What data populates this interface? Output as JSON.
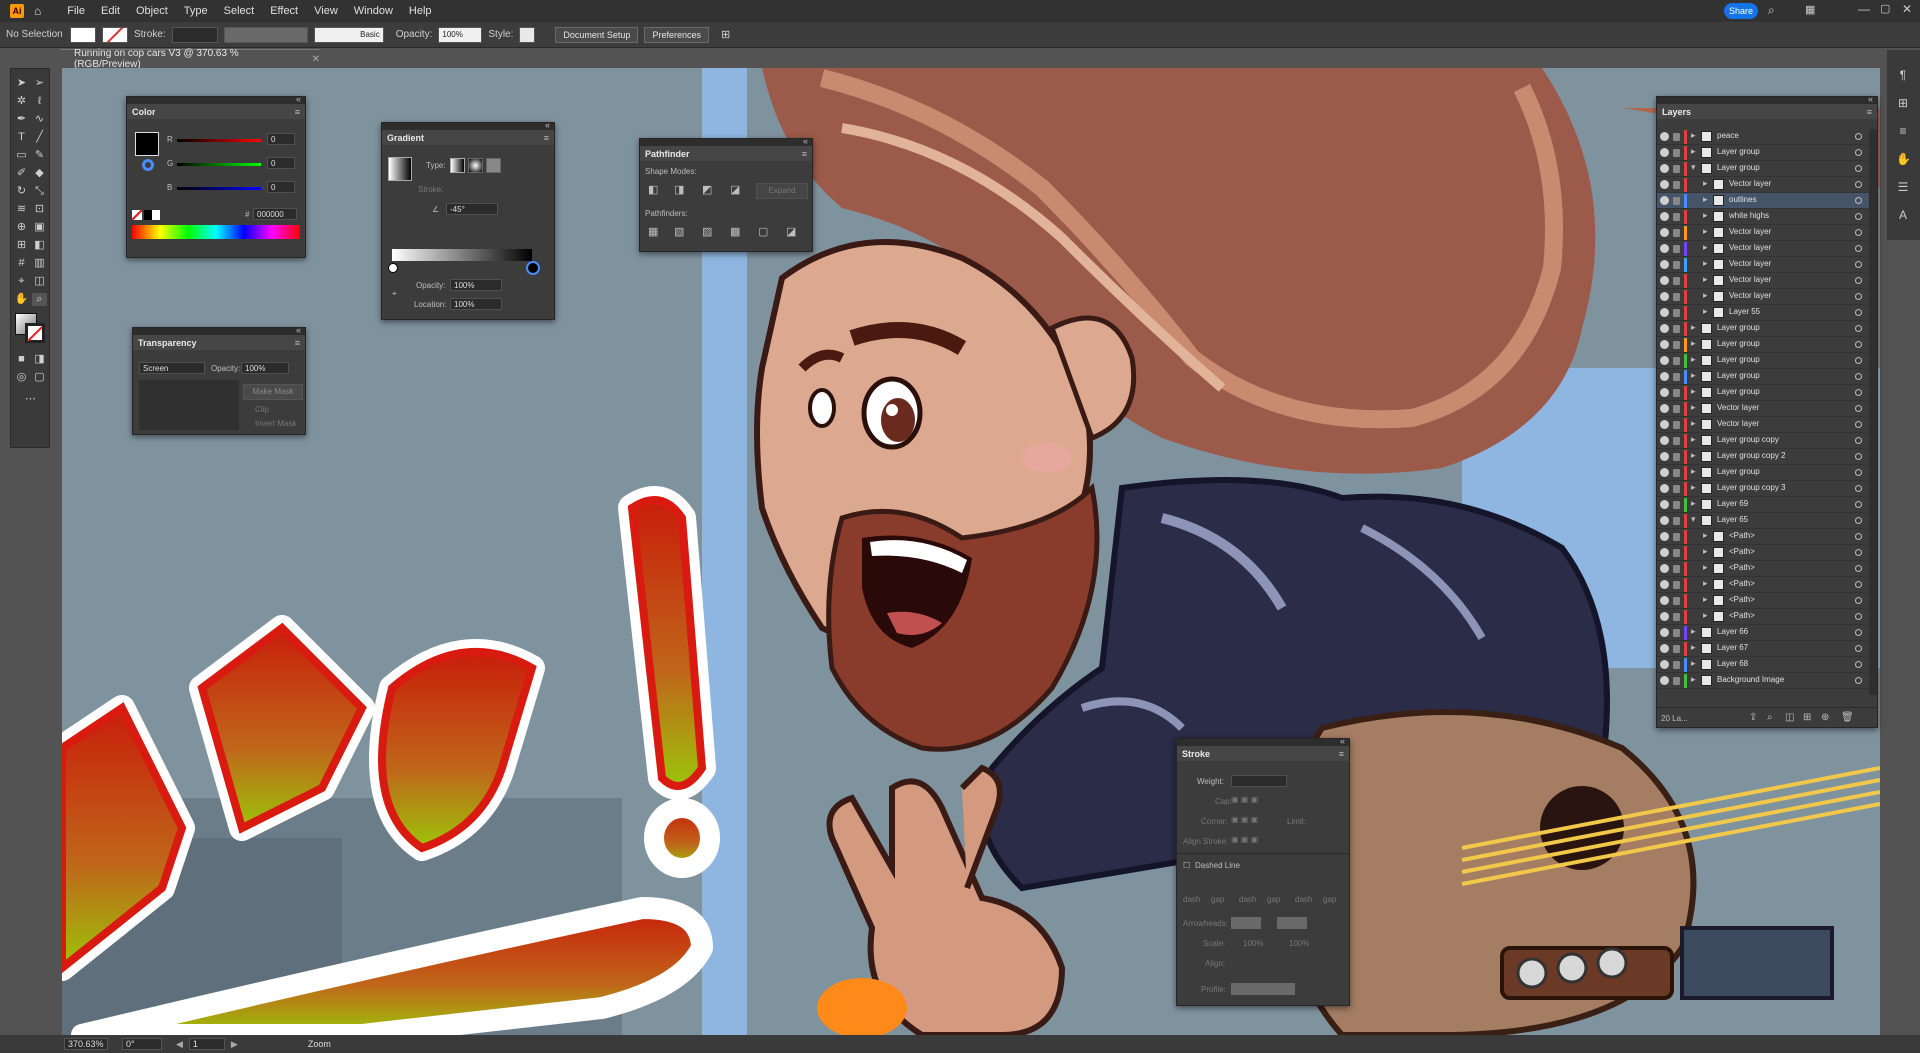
{
  "app": {
    "logo": "Ai",
    "share_label": "Share"
  },
  "menu": [
    "File",
    "Edit",
    "Object",
    "Type",
    "Select",
    "Effect",
    "View",
    "Window",
    "Help"
  ],
  "control_bar": {
    "selection": "No Selection",
    "stroke_label": "Stroke:",
    "brush_label": "Basic",
    "opacity_label": "Opacity:",
    "opacity_value": "100%",
    "style_label": "Style:",
    "document_setup": "Document Setup",
    "preferences": "Preferences"
  },
  "document_tab": {
    "title": "Running on cop cars V3 @ 370.63 % (RGB/Preview)"
  },
  "color_panel": {
    "title": "Color",
    "channels": [
      {
        "label": "R",
        "value": "0"
      },
      {
        "label": "G",
        "value": "0"
      },
      {
        "label": "B",
        "value": "0"
      }
    ],
    "hex_prefix": "#",
    "hex": "000000"
  },
  "gradient_panel": {
    "title": "Gradient",
    "type_label": "Type:",
    "stroke_label": "Stroke:",
    "angle": "-45°",
    "opacity_label": "Opacity:",
    "opacity": "100%",
    "location_label": "Location:",
    "location": "100%"
  },
  "pathfinder_panel": {
    "title": "Pathfinder",
    "shape_modes": "Shape Modes:",
    "expand": "Expand",
    "pathfinders": "Pathfinders:"
  },
  "transparency_panel": {
    "title": "Transparency",
    "mode": "Screen",
    "opacity_label": "Opacity:",
    "opacity": "100%",
    "make_mask": "Make Mask",
    "clip": "Clip",
    "invert_mask": "Invert Mask"
  },
  "stroke_panel": {
    "title": "Stroke",
    "weight_label": "Weight:",
    "cap_label": "Cap:",
    "corner_label": "Corner:",
    "limit_label": "Limit:",
    "align_label": "Align Stroke:",
    "dashed_line": "Dashed Line",
    "dash_labels": [
      "dash",
      "gap",
      "dash",
      "gap",
      "dash",
      "gap"
    ],
    "arrowheads_label": "Arrowheads:",
    "scale_label": "Scale:",
    "scale_values": [
      "100%",
      "100%"
    ],
    "align2_label": "Align:",
    "profile_label": "Profile:"
  },
  "layers_panel": {
    "title": "Layers",
    "footer": "20 La...",
    "rows": [
      {
        "name": "peace",
        "indent": 0,
        "color": "#e04040",
        "expanded": false,
        "selected": false
      },
      {
        "name": "Layer group",
        "indent": 0,
        "color": "#e04040",
        "expanded": false,
        "selected": false
      },
      {
        "name": "Layer group",
        "indent": 0,
        "color": "#e04040",
        "expanded": true,
        "selected": false
      },
      {
        "name": "Vector layer",
        "indent": 1,
        "color": "#e04040",
        "expanded": false,
        "selected": false
      },
      {
        "name": "outlines",
        "indent": 1,
        "color": "#4a8cff",
        "expanded": false,
        "selected": true
      },
      {
        "name": "white highs",
        "indent": 1,
        "color": "#e04040",
        "expanded": false,
        "selected": false
      },
      {
        "name": "Vector layer",
        "indent": 1,
        "color": "#ff9a20",
        "expanded": false,
        "selected": false
      },
      {
        "name": "Vector layer",
        "indent": 1,
        "color": "#7a40ff",
        "expanded": false,
        "selected": false
      },
      {
        "name": "Vector layer",
        "indent": 1,
        "color": "#40a0ff",
        "expanded": false,
        "selected": false
      },
      {
        "name": "Vector layer",
        "indent": 1,
        "color": "#e04040",
        "expanded": false,
        "selected": false
      },
      {
        "name": "Vector layer",
        "indent": 1,
        "color": "#e04040",
        "expanded": false,
        "selected": false
      },
      {
        "name": "Layer 55",
        "indent": 1,
        "color": "#e04040",
        "expanded": false,
        "selected": false
      },
      {
        "name": "Layer group",
        "indent": 0,
        "color": "#e04040",
        "expanded": false,
        "selected": false
      },
      {
        "name": "Layer group",
        "indent": 0,
        "color": "#ff9a20",
        "expanded": false,
        "selected": false
      },
      {
        "name": "Layer group",
        "indent": 0,
        "color": "#40c040",
        "expanded": false,
        "selected": false
      },
      {
        "name": "Layer group",
        "indent": 0,
        "color": "#4a8cff",
        "expanded": false,
        "selected": false
      },
      {
        "name": "Layer group",
        "indent": 0,
        "color": "#e04040",
        "expanded": false,
        "selected": false
      },
      {
        "name": "Vector layer",
        "indent": 0,
        "color": "#e04040",
        "expanded": false,
        "selected": false
      },
      {
        "name": "Vector layer",
        "indent": 0,
        "color": "#e04040",
        "expanded": false,
        "selected": false
      },
      {
        "name": "Layer group copy",
        "indent": 0,
        "color": "#e04040",
        "expanded": false,
        "selected": false
      },
      {
        "name": "Layer group copy 2",
        "indent": 0,
        "color": "#e04040",
        "expanded": false,
        "selected": false
      },
      {
        "name": "Layer group",
        "indent": 0,
        "color": "#e04040",
        "expanded": false,
        "selected": false
      },
      {
        "name": "Layer group copy 3",
        "indent": 0,
        "color": "#e04040",
        "expanded": false,
        "selected": false
      },
      {
        "name": "Layer 69",
        "indent": 0,
        "color": "#40c040",
        "expanded": false,
        "selected": false
      },
      {
        "name": "Layer 65",
        "indent": 0,
        "color": "#e04040",
        "expanded": true,
        "selected": false
      },
      {
        "name": "<Path>",
        "indent": 1,
        "color": "#e04040",
        "expanded": false,
        "selected": false
      },
      {
        "name": "<Path>",
        "indent": 1,
        "color": "#e04040",
        "expanded": false,
        "selected": false
      },
      {
        "name": "<Path>",
        "indent": 1,
        "color": "#e04040",
        "expanded": false,
        "selected": false
      },
      {
        "name": "<Path>",
        "indent": 1,
        "color": "#e04040",
        "expanded": false,
        "selected": false
      },
      {
        "name": "<Path>",
        "indent": 1,
        "color": "#e04040",
        "expanded": false,
        "selected": false
      },
      {
        "name": "<Path>",
        "indent": 1,
        "color": "#e04040",
        "expanded": false,
        "selected": false
      },
      {
        "name": "Layer 66",
        "indent": 0,
        "color": "#7a40ff",
        "expanded": false,
        "selected": false
      },
      {
        "name": "Layer 67",
        "indent": 0,
        "color": "#e04040",
        "expanded": false,
        "selected": false
      },
      {
        "name": "Layer 68",
        "indent": 0,
        "color": "#4a8cff",
        "expanded": false,
        "selected": false
      },
      {
        "name": "Background Image",
        "indent": 0,
        "color": "#40c040",
        "expanded": false,
        "selected": false
      }
    ]
  },
  "status_bar": {
    "zoom": "370.63%",
    "rotation": "0°",
    "artboard": "1",
    "tool": "Zoom"
  },
  "colors": {
    "accent": "#1473e6",
    "panel_bg": "#3c3c3c",
    "selected_row": "#46546a"
  }
}
